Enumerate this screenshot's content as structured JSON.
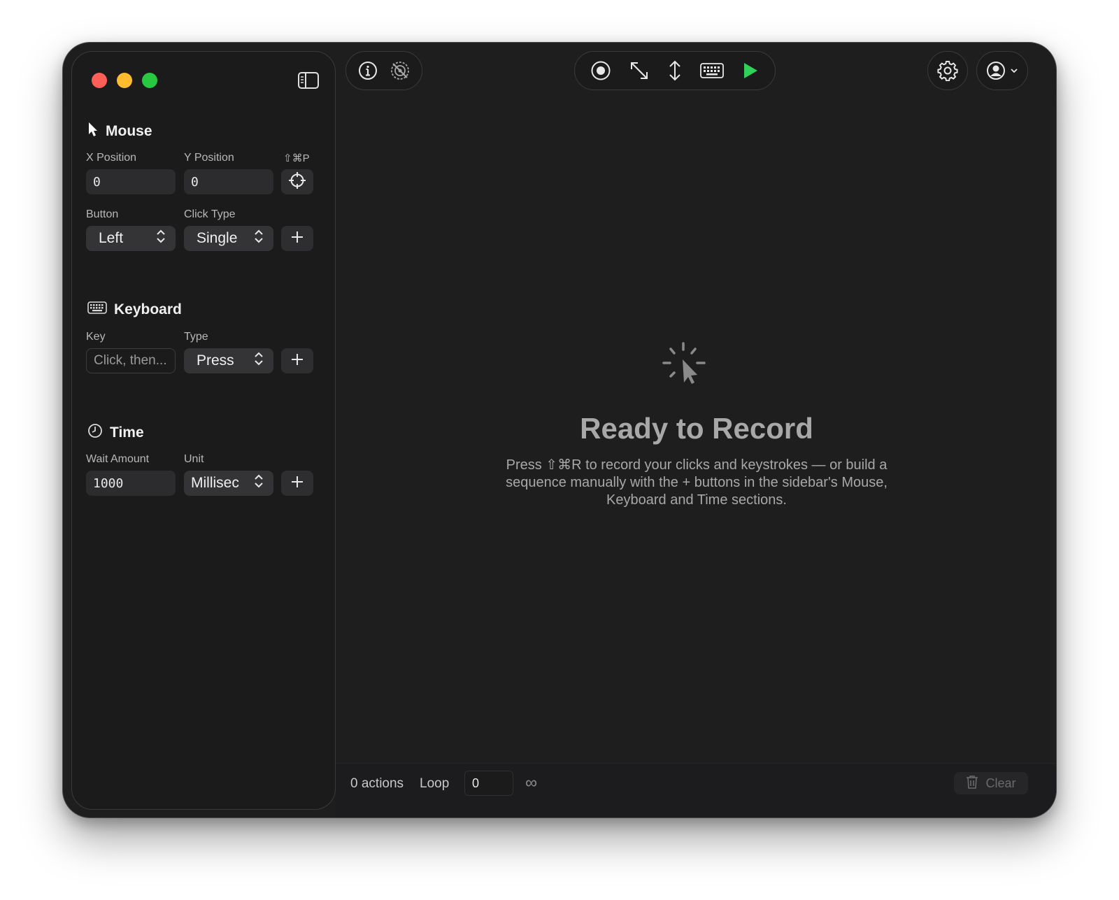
{
  "sidebar": {
    "mouse": {
      "title": "Mouse",
      "x_label": "X Position",
      "y_label": "Y Position",
      "shortcut": "⇧⌘P",
      "x_value": "0",
      "y_value": "0",
      "button_label": "Button",
      "click_type_label": "Click Type",
      "button_value": "Left",
      "click_type_value": "Single"
    },
    "keyboard": {
      "title": "Keyboard",
      "key_label": "Key",
      "type_label": "Type",
      "key_placeholder": "Click, then...",
      "type_value": "Press"
    },
    "time": {
      "title": "Time",
      "wait_label": "Wait Amount",
      "unit_label": "Unit",
      "wait_value": "1000",
      "unit_value": "Millisec"
    }
  },
  "main": {
    "empty_title": "Ready to Record",
    "empty_description": "Press ⇧⌘R to record your clicks and keystrokes — or build a sequence manually with the + buttons in the sidebar's Mouse, Keyboard and Time sections."
  },
  "footer": {
    "actions_count": "0 actions",
    "loop_label": "Loop",
    "loop_value": "0",
    "infinity_symbol": "∞",
    "clear_label": "Clear"
  },
  "colors": {
    "play_green": "#30d158",
    "traffic_red": "#ff5f57",
    "traffic_yellow": "#febc2e",
    "traffic_green": "#28c840"
  }
}
